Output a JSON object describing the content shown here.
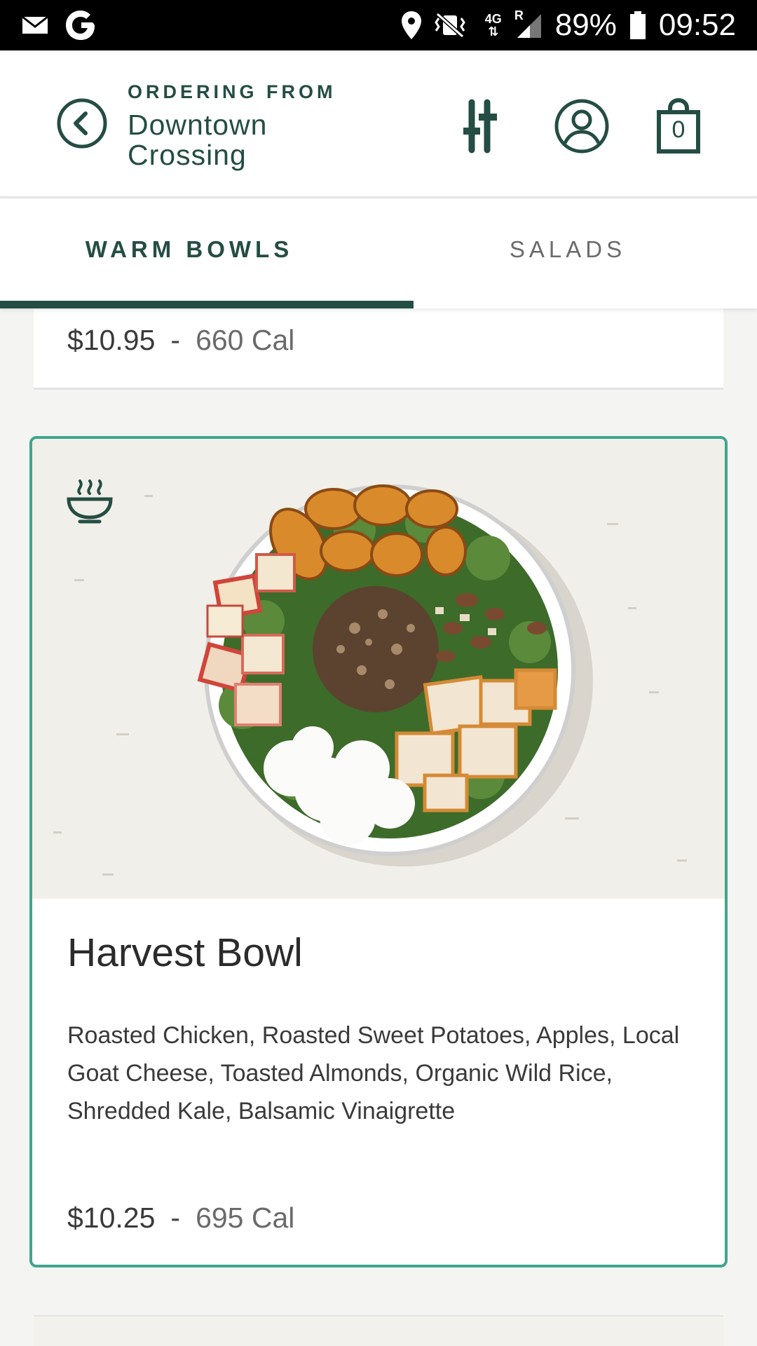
{
  "status_bar": {
    "battery": "89%",
    "time": "09:52",
    "network": "4G",
    "roaming": "R",
    "icons": [
      "mail-icon",
      "google-icon",
      "location-icon",
      "mute-vibrate-icon",
      "signal-icon",
      "battery-icon"
    ]
  },
  "header": {
    "ordering_label": "ORDERING FROM",
    "location": "Downtown Crossing",
    "bag_count": "0"
  },
  "tabs": [
    {
      "label": "WARM BOWLS",
      "active": true
    },
    {
      "label": "SALADS",
      "active": false
    }
  ],
  "previous_item": {
    "price": "$10.95",
    "separator": "-",
    "calories": "660 Cal"
  },
  "item": {
    "badge_icon": "warm-bowl-icon",
    "name": "Harvest Bowl",
    "description": "Roasted Chicken, Roasted Sweet Potatoes, Apples, Local Goat Cheese, Toasted Almonds, Organic Wild Rice, Shredded Kale, Balsamic Vinaigrette",
    "price": "$10.25",
    "separator": "-",
    "calories": "695 Cal"
  },
  "colors": {
    "brand_green": "#244d43",
    "card_border": "#3fa68c"
  }
}
